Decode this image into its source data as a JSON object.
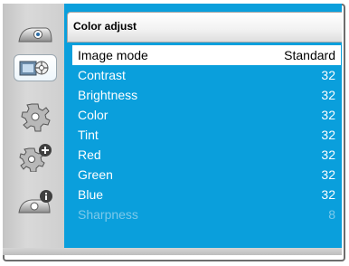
{
  "menu": {
    "title": "Color adjust",
    "items": [
      {
        "label": "Image mode",
        "value": "Standard"
      },
      {
        "label": "Contrast",
        "value": "32"
      },
      {
        "label": "Brightness",
        "value": "32"
      },
      {
        "label": "Color",
        "value": "32"
      },
      {
        "label": "Tint",
        "value": "32"
      },
      {
        "label": "Red",
        "value": "32"
      },
      {
        "label": "Green",
        "value": "32"
      },
      {
        "label": "Blue",
        "value": "32"
      },
      {
        "label": "Sharpness",
        "value": "8"
      }
    ],
    "selected_index": 0,
    "disabled_index": 8
  },
  "sidebar": {
    "icons": [
      "display-icon",
      "color-adjust-icon",
      "gear-icon",
      "gear-plus-icon",
      "info-icon"
    ],
    "active_index": 1
  },
  "colors": {
    "panel_blue": "#0a9fdc",
    "disabled_text": "#7cc9ea"
  }
}
